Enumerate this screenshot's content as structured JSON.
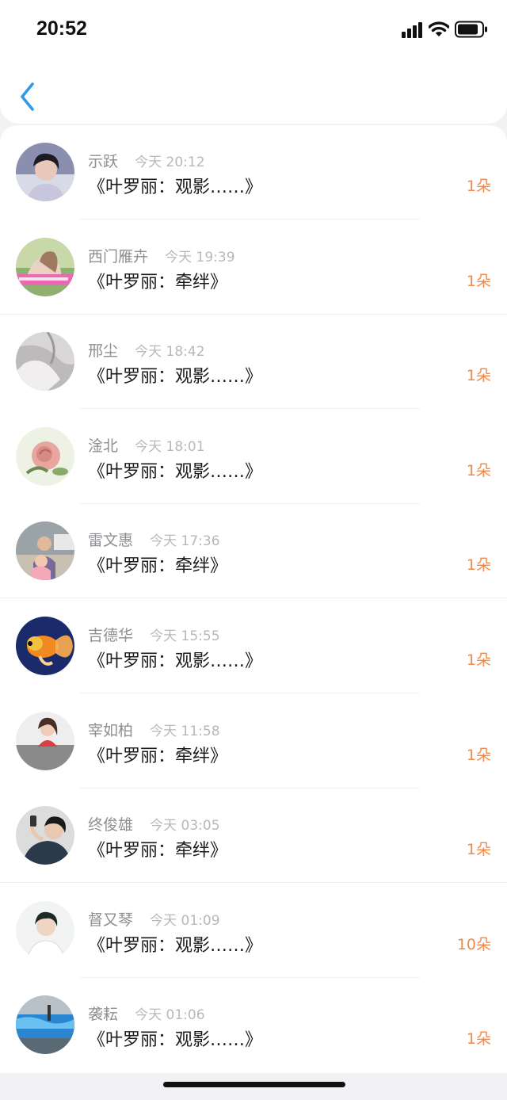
{
  "status_bar": {
    "time": "20:52",
    "icons": [
      "cellular-signal-icon",
      "wifi-icon",
      "battery-icon"
    ]
  },
  "nav": {
    "back_icon": "chevron-left-icon"
  },
  "colors": {
    "accent_blue": "#2f9be8",
    "count_orange": "#ee8a4a",
    "name_gray": "#8e8e93",
    "time_gray": "#b8b8bc"
  },
  "gifts": [
    {
      "name": "示跃",
      "time": "今天 20:12",
      "title": "《叶罗丽：观影……》",
      "count": "1朵",
      "avatar": "portrait-avatar"
    },
    {
      "name": "西门雁卉",
      "time": "今天 19:39",
      "title": "《叶罗丽：牵绊》",
      "count": "1朵",
      "avatar": "girl-outdoor-avatar"
    },
    {
      "name": "邢尘",
      "time": "今天 18:42",
      "title": "《叶罗丽：观影……》",
      "count": "1朵",
      "avatar": "fabric-avatar"
    },
    {
      "name": "淦北",
      "time": "今天 18:01",
      "title": "《叶罗丽：观影……》",
      "count": "1朵",
      "avatar": "rose-avatar"
    },
    {
      "name": "雷文惠",
      "time": "今天 17:36",
      "title": "《叶罗丽：牵绊》",
      "count": "1朵",
      "avatar": "kids-avatar"
    },
    {
      "name": "吉德华",
      "time": "今天 15:55",
      "title": "《叶罗丽：观影……》",
      "count": "1朵",
      "avatar": "goldfish-avatar"
    },
    {
      "name": "宰如柏",
      "time": "今天 11:58",
      "title": "《叶罗丽：牵绊》",
      "count": "1朵",
      "avatar": "girl-avatar"
    },
    {
      "name": "终俊雄",
      "time": "今天 03:05",
      "title": "《叶罗丽：牵绊》",
      "count": "1朵",
      "avatar": "boy-phone-avatar"
    },
    {
      "name": "督又琴",
      "time": "今天 01:09",
      "title": "《叶罗丽：观影……》",
      "count": "10朵",
      "avatar": "young-man-avatar"
    },
    {
      "name": "袭耘",
      "time": "今天 01:06",
      "title": "《叶罗丽：观影……》",
      "count": "1朵",
      "avatar": "ocean-avatar"
    }
  ]
}
